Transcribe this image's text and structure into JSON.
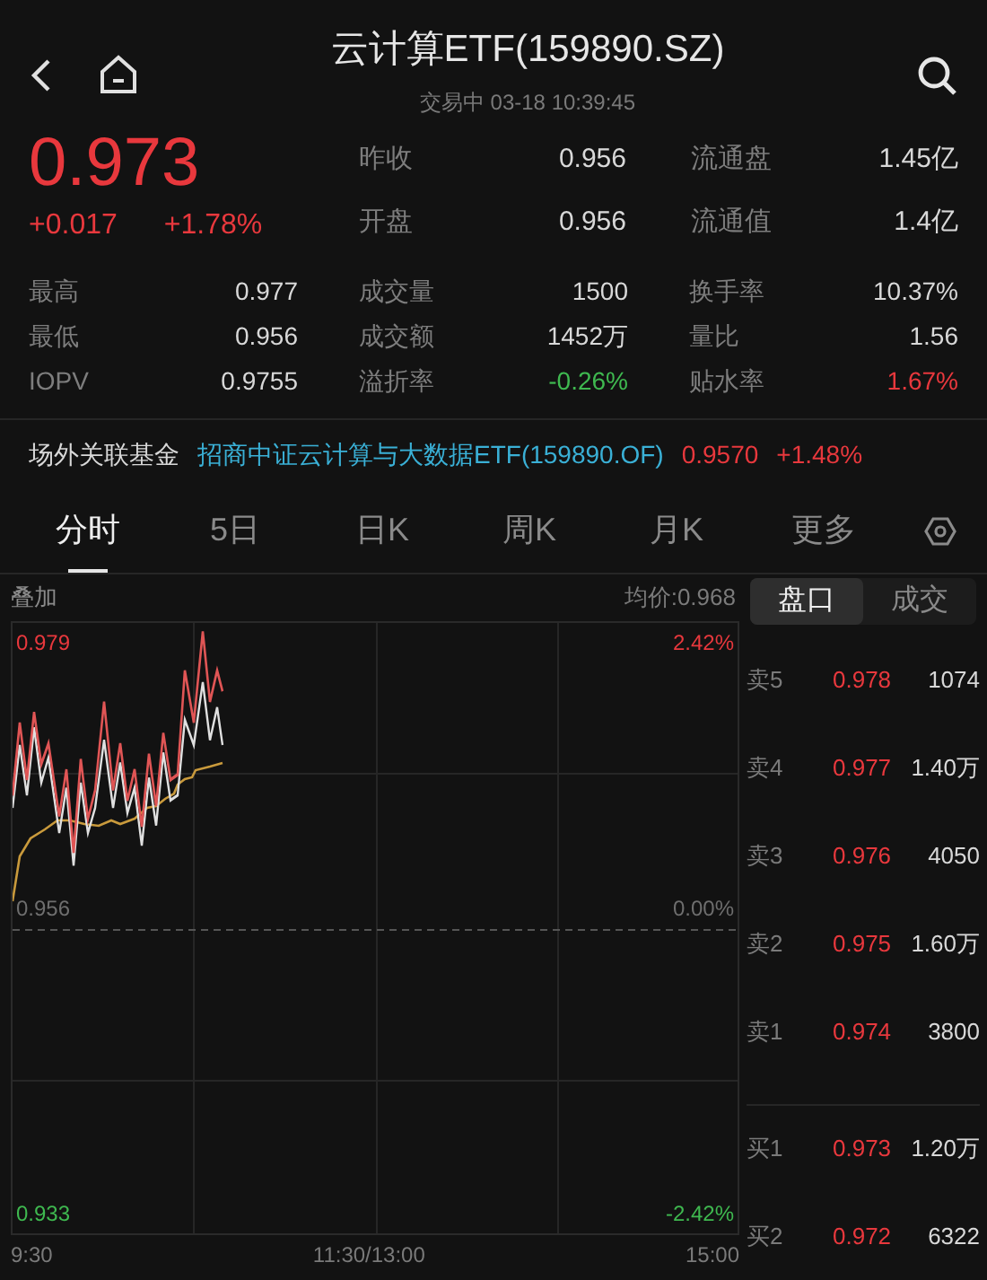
{
  "header": {
    "title": "云计算ETF(159890.SZ)",
    "subtitle": "交易中 03-18 10:39:45"
  },
  "quote": {
    "price": "0.973",
    "change": "+0.017",
    "change_pct": "+1.78%",
    "color": "#e8383d"
  },
  "quote_stats": [
    {
      "label": "昨收",
      "value": "0.956",
      "color": "#d8d8d8"
    },
    {
      "label": "流通盘",
      "value": "1.45亿",
      "color": "#d8d8d8"
    },
    {
      "label": "开盘",
      "value": "0.956",
      "color": "#d8d8d8"
    },
    {
      "label": "流通值",
      "value": "1.4亿",
      "color": "#d8d8d8"
    }
  ],
  "stats": [
    {
      "label": "最高",
      "value": "0.977",
      "color": "#d8d8d8"
    },
    {
      "label": "成交量",
      "value": "1500",
      "color": "#d8d8d8"
    },
    {
      "label": "换手率",
      "value": "10.37%",
      "color": "#d8d8d8"
    },
    {
      "label": "最低",
      "value": "0.956",
      "color": "#d8d8d8"
    },
    {
      "label": "成交额",
      "value": "1452万",
      "color": "#d8d8d8"
    },
    {
      "label": "量比",
      "value": "1.56",
      "color": "#d8d8d8"
    },
    {
      "label": "IOPV",
      "value": "0.9755",
      "color": "#d8d8d8"
    },
    {
      "label": "溢折率",
      "value": "-0.26%",
      "color": "#3fb950"
    },
    {
      "label": "贴水率",
      "value": "1.67%",
      "color": "#e8383d"
    }
  ],
  "related_fund": {
    "label": "场外关联基金",
    "name": "招商中证云计算与大数据ETF(159890.OF)",
    "price": "0.9570",
    "change_pct": "+1.48%"
  },
  "tabs": [
    {
      "label": "分时",
      "selected": true
    },
    {
      "label": "5日",
      "selected": false
    },
    {
      "label": "日K",
      "selected": false
    },
    {
      "label": "周K",
      "selected": false
    },
    {
      "label": "月K",
      "selected": false
    },
    {
      "label": "更多",
      "selected": false
    }
  ],
  "chart": {
    "overlay": "叠加",
    "avg_price": "均价:0.968",
    "high": "0.979",
    "high_pct": "2.42%",
    "base": "0.956",
    "base_pct": "0.00%",
    "low": "0.933",
    "low_pct": "-2.42%",
    "times": [
      "9:30",
      "11:30/13:00",
      "15:00"
    ]
  },
  "book_tabs": [
    {
      "label": "盘口",
      "selected": true
    },
    {
      "label": "成交",
      "selected": false
    }
  ],
  "order_book": [
    {
      "label": "卖5",
      "price": "0.978",
      "volume": "1074"
    },
    {
      "label": "卖4",
      "price": "0.977",
      "volume": "1.40万"
    },
    {
      "label": "卖3",
      "price": "0.976",
      "volume": "4050"
    },
    {
      "label": "卖2",
      "price": "0.975",
      "volume": "1.60万"
    },
    {
      "label": "卖1",
      "price": "0.974",
      "volume": "3800"
    },
    {
      "label": "买1",
      "price": "0.973",
      "volume": "1.20万"
    },
    {
      "label": "买2",
      "price": "0.972",
      "volume": "6322"
    }
  ]
}
